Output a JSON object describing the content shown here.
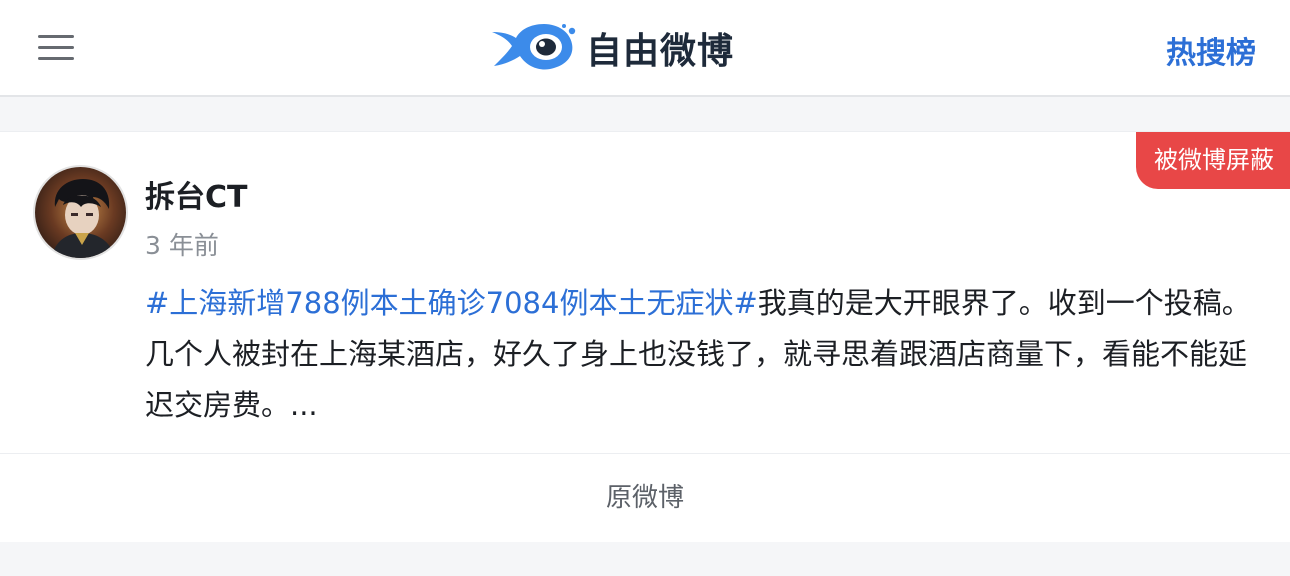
{
  "header": {
    "menu_icon": "hamburger-menu-icon",
    "logo_icon": "fish-eye-logo-icon",
    "brand_name": "自由微博",
    "hot_search_label": "热搜榜"
  },
  "post": {
    "badge": "被微博屏蔽",
    "author": "拆台CT",
    "time": "3 年前",
    "hashtag": "#上海新增788例本土确诊7084例本土无症状#",
    "body": "我真的是大开眼界了。收到一个投稿。几个人被封在上海某酒店，好久了身上也没钱了，就寻思着跟酒店商量下，看能不能延迟交房费。...",
    "original_link": "原微博"
  },
  "colors": {
    "accent": "#2c6fd6",
    "badge": "#e84747",
    "logo_blue": "#3c8bea"
  }
}
